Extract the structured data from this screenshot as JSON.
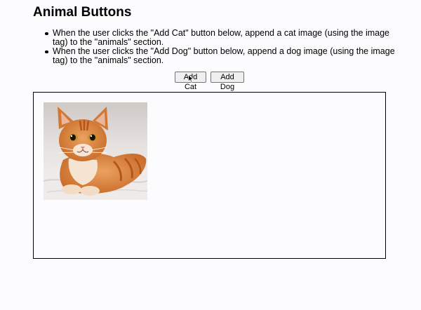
{
  "page": {
    "title": "Animal Buttons",
    "instructions": [
      "When the user clicks the \"Add Cat\" button below, append a cat image (using the image tag) to the \"animals\" section.",
      "When the user clicks the \"Add Dog\" button below, append a dog image (using the image tag) to the \"animals\" section."
    ]
  },
  "buttons": {
    "add_cat": "Add Cat",
    "add_dog": "Add Dog"
  },
  "animals": {
    "images": [
      {
        "kind": "cat",
        "icon": "cat-photo"
      }
    ]
  },
  "colors": {
    "background": "#fcfbfd",
    "button_bg": "#efefef",
    "button_border": "#767676",
    "cat_orange": "#d9823e"
  }
}
